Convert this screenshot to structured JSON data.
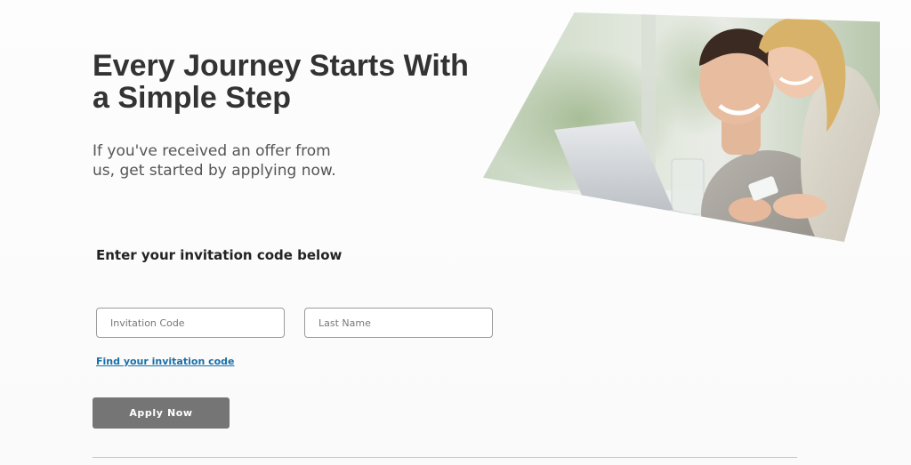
{
  "hero": {
    "headline": "Every Journey Starts With a Simple Step",
    "subtext": "If you've received an offer from us, get started by applying now."
  },
  "form": {
    "section_title": "Enter your invitation code below",
    "invitation_code_placeholder": "Invitation Code",
    "invitation_code_value": "",
    "last_name_placeholder": "Last Name",
    "last_name_value": "",
    "find_code_link": "Find your invitation code",
    "apply_button": "Apply Now"
  },
  "colors": {
    "heading_text": "#333333",
    "body_text": "#555555",
    "link": "#1a6fa8",
    "button_bg": "#757575",
    "button_text": "#ffffff",
    "field_border": "#9a9a9a"
  }
}
